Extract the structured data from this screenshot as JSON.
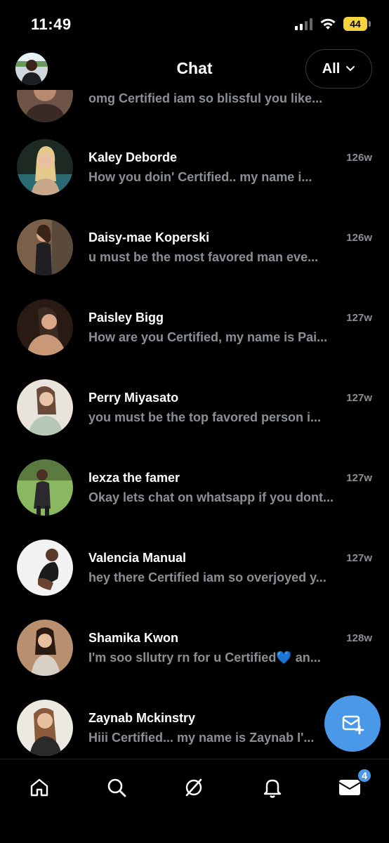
{
  "status_bar": {
    "time": "11:49",
    "battery": "44"
  },
  "header": {
    "title": "Chat",
    "filter_label": "All"
  },
  "chats": [
    {
      "name": "",
      "time": "",
      "preview": "omg  Certified  iam so blissful you  like..."
    },
    {
      "name": "Kaley Deborde",
      "time": "126w",
      "preview": "How    you    doin' Certified.. my name  i..."
    },
    {
      "name": "Daisy-mae Koperski",
      "time": "126w",
      "preview": "u must  be   the   most  favored man eve..."
    },
    {
      "name": "Paisley Bigg",
      "time": "127w",
      "preview": "How are you Certified, my  name is  Pai..."
    },
    {
      "name": "Perry Miyasato",
      "time": "127w",
      "preview": "you must  be  the top  favored person i..."
    },
    {
      "name": "lexza the famer",
      "time": "127w",
      "preview": "Okay lets chat on whatsapp if you dont..."
    },
    {
      "name": "Valencia Manual",
      "time": "127w",
      "preview": "hey there Certified iam  so overjoyed  y..."
    },
    {
      "name": "Shamika Kwon",
      "time": "128w",
      "preview": "I'm  soo sllutry  rn for u  Certified💙 an..."
    },
    {
      "name": "Zaynab Mckinstry",
      "time": "",
      "preview": "Hiii   Certified...  my name is Zaynab  I'..."
    }
  ],
  "bottom_nav": {
    "items": [
      "home-icon",
      "search-icon",
      "grok-icon",
      "bell-icon",
      "mail-icon"
    ],
    "messages_badge": "4"
  },
  "colors": {
    "accent": "#4a99e9",
    "secondary_text": "#8b8f94",
    "battery": "#f5d33c"
  }
}
